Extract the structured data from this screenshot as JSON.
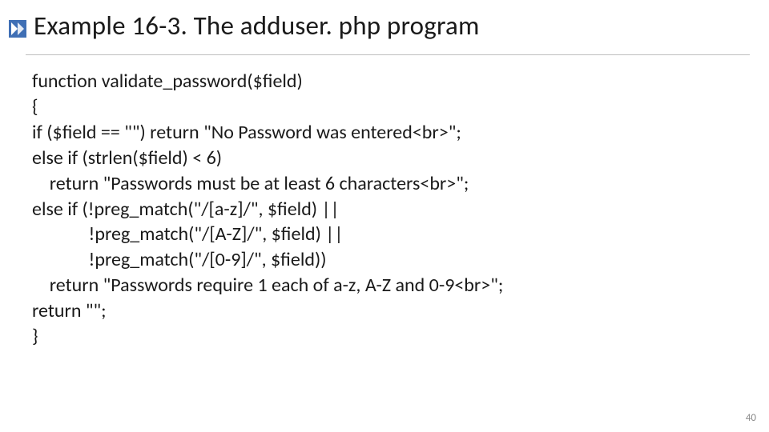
{
  "title": "Example 16-3. The adduser. php program",
  "code": {
    "l1": "function validate_password($field)",
    "l2": "{",
    "l3": "if ($field == \"\") return \"No Password was entered<br>\";",
    "l4": "else if (strlen($field) < 6)",
    "l5": "    return \"Passwords must be at least 6 characters<br>\";",
    "l6": "else if (!preg_match(\"/[a-z]/\", $field) ||",
    "l7": "             !preg_match(\"/[A-Z]/\", $field) ||",
    "l8": "             !preg_match(\"/[0-9]/\", $field))",
    "l9": "    return \"Passwords require 1 each of a-z, A-Z and 0-9<br>\";",
    "l10": "return \"\";",
    "l11": "}"
  },
  "page_number": "40"
}
